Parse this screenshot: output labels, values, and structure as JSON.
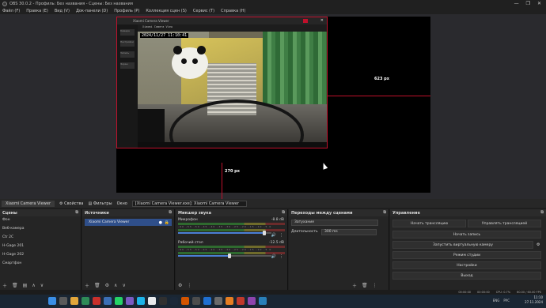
{
  "window": {
    "title": "OBS 30.0.2 - Профиль: Без названия - Сцены: Без названия",
    "controls": [
      "—",
      "❐",
      "✕"
    ]
  },
  "menu": [
    "Файл (F)",
    "Правка (E)",
    "Вид (V)",
    "Док-панели (D)",
    "Профиль (P)",
    "Коллекция сцен (S)",
    "Сервис (T)",
    "Справка (H)"
  ],
  "preview": {
    "camera_window_title": "Xiaomi Camera Viewer",
    "camera_sub_title": "Xiaomi Camera View",
    "camera_side_items": [
      "Камера",
      "Настройки",
      "Запись",
      "Экран"
    ],
    "timestamp": "2024/11/27  11:10:41",
    "guide_right_label": "623 px",
    "guide_bottom_label": "270 px"
  },
  "source_toolbar": {
    "source_name": "Xiaomi Camera Viewer",
    "properties": "Свойства",
    "filters": "Фильтры",
    "window_label": "Окно",
    "window_value": "[Xiaomi Camera Viewer.exe]: Xiaomi Camera Viewer"
  },
  "scenes": {
    "title": "Сцены",
    "items": [
      "Фон",
      "Веб-камера",
      "Сtr 2С",
      "H-Gage 201",
      "H-Gage 202",
      "Смартфон"
    ]
  },
  "sources": {
    "title": "Источники",
    "items": [
      {
        "label": "Xiaomi Camera Viewer"
      }
    ]
  },
  "mixer": {
    "title": "Микшер звука",
    "channels": [
      {
        "name": "Микрофон",
        "db": "-8.8 dB",
        "level": 0.92
      },
      {
        "name": "Рабочий стол",
        "db": "-12.5 dB",
        "level": 0.55
      }
    ],
    "scale": "-60 -55 -50 -45 -40 -35 -30 -25 -20 -15 -10 -5 0"
  },
  "transitions": {
    "title": "Переходы между сценами",
    "type": "Затухание",
    "duration_label": "Длительность",
    "duration_value": "300 ms"
  },
  "controls": {
    "title": "Управление",
    "start_stream": "Начать трансляцию",
    "virtual_cam": "Управлять трансляцией",
    "start_record": "Начать запись",
    "virtual_camera": "Запустить виртуальную камеру",
    "studio_mode": "Режим студии",
    "settings": "Настройки",
    "exit": "Выход"
  },
  "status": {
    "time1": "00:00:00",
    "time2": "00:00:00",
    "cpu": "CPU: 0.7%",
    "fps": "60.00 / 60.00 FPS"
  },
  "taskbar": {
    "tray_icons": [
      "ENG",
      "РУС"
    ],
    "clock_time": "11:10",
    "clock_date": "27.11.2024"
  }
}
